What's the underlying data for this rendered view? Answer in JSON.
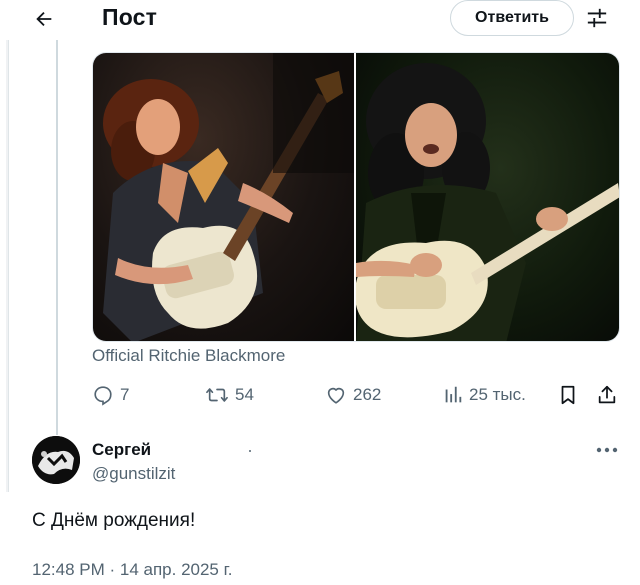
{
  "header": {
    "back_icon": "arrow-left-icon",
    "title": "Пост",
    "reply_label": "Ответить",
    "filter_icon": "sliders-icon"
  },
  "post": {
    "media_caption": "Official Ritchie Blackmore",
    "actions": {
      "replies": "7",
      "reposts": "54",
      "likes": "262",
      "views": "25 тыс."
    },
    "icons": [
      "comment-icon",
      "repost-icon",
      "heart-icon",
      "views-chart-icon",
      "bookmark-icon",
      "share-icon"
    ]
  },
  "reply": {
    "display_name": "Сергей",
    "handle": "@gunstilzit",
    "text": "С Днём рождения!",
    "timestamp": "12:48 PM · 14 апр. 2025 г."
  },
  "colors": {
    "text_primary": "#0f1419",
    "text_secondary": "#536471",
    "border": "#cfd9de"
  }
}
